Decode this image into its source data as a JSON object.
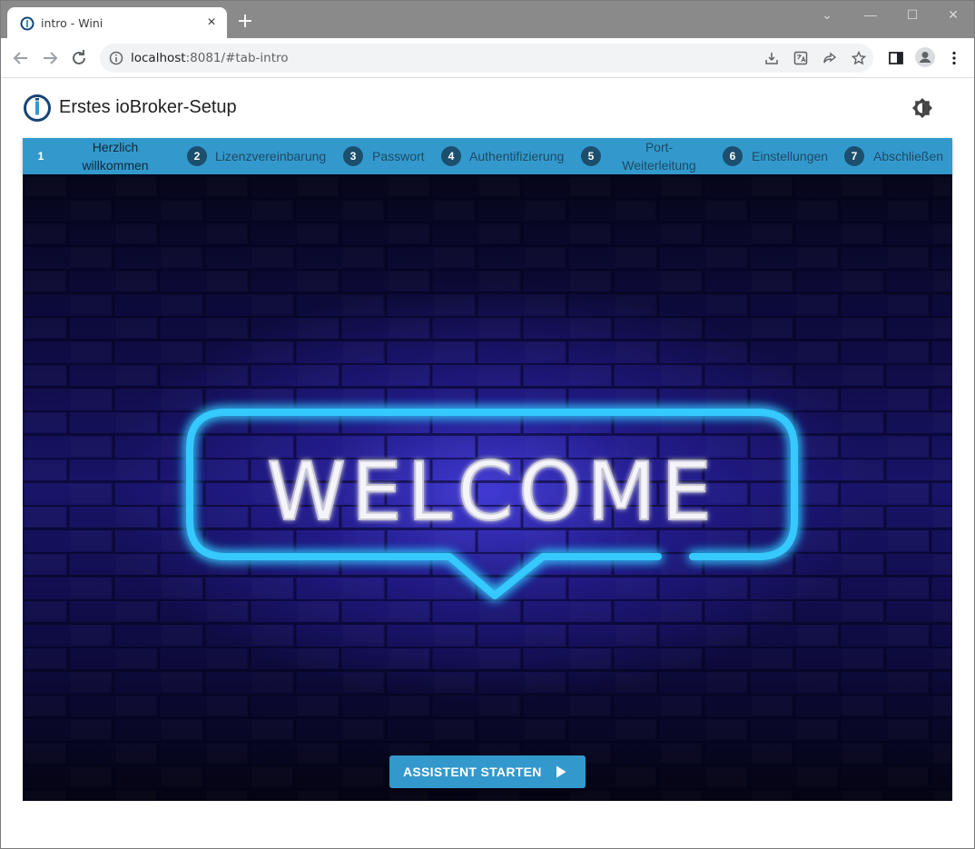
{
  "browser": {
    "tab_title": "intro - Wini",
    "tab_close": "×",
    "new_tab": "+",
    "url_host": "localhost",
    "url_path": ":8081/#tab-intro",
    "window_controls": {
      "chevron": "⌄",
      "minimize": "—",
      "maximize": "☐",
      "close": "✕"
    }
  },
  "app": {
    "title": "Erstes ioBroker-Setup"
  },
  "steps": [
    {
      "number": "1",
      "label_line1": "Herzlich",
      "label_line2": "willkommen",
      "active": true
    },
    {
      "number": "2",
      "label": "Lizenzvereinbarung",
      "active": false
    },
    {
      "number": "3",
      "label": "Passwort",
      "active": false
    },
    {
      "number": "4",
      "label": "Authentifizierung",
      "active": false
    },
    {
      "number": "5",
      "label_line1": "Port-",
      "label_line2": "Weiterleitung",
      "active": false
    },
    {
      "number": "6",
      "label": "Einstellungen",
      "active": false
    },
    {
      "number": "7",
      "label": "Abschließen",
      "active": false
    }
  ],
  "hero": {
    "sign_text": "WELCOME"
  },
  "start_button": {
    "label": "ASSISTENT STARTEN",
    "icon": "play-icon"
  },
  "colors": {
    "accent": "#3399cc",
    "step_circle": "#1c4f6e",
    "neon": "#35c9ff"
  }
}
